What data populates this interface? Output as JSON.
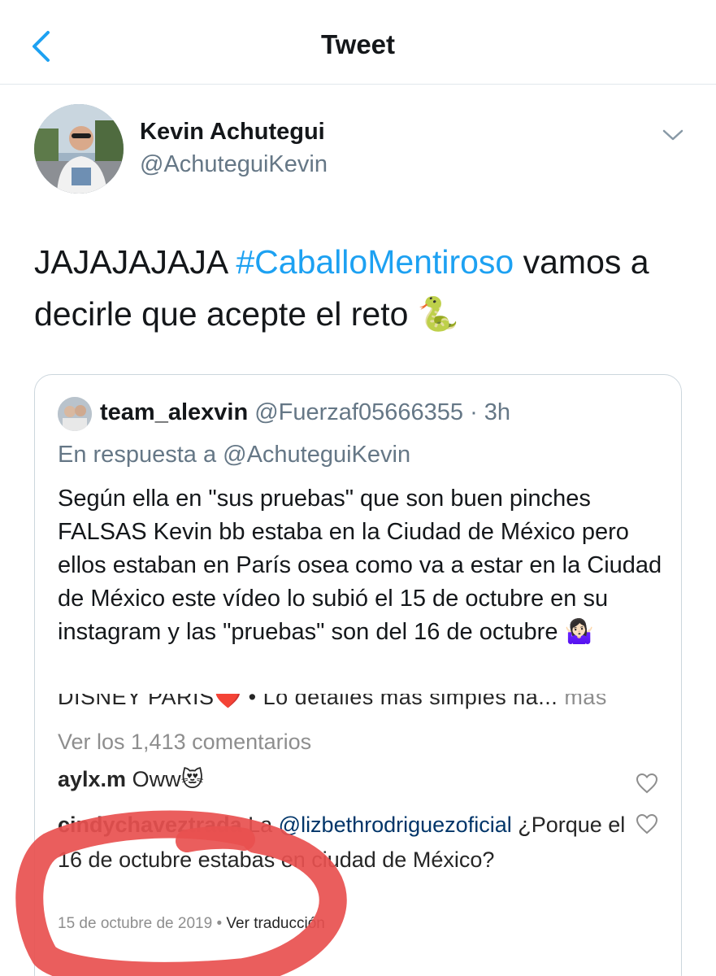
{
  "nav": {
    "title": "Tweet"
  },
  "tweet": {
    "author_name": "Kevin Achutegui",
    "author_handle": "@AchuteguiKevin",
    "text_before": "JAJAJAJAJA ",
    "hashtag": "#CaballoMentiroso",
    "text_after": " vamos a decirle que acepte el reto ",
    "emoji": "🐍"
  },
  "quote": {
    "name": "team_alexvin",
    "handle": "@Fuerzaf05666355",
    "sep": " · ",
    "time": "3h",
    "reply_to": "En respuesta a @AchuteguiKevin",
    "text": "Según ella en \"sus pruebas\" que son buen pinches FALSAS Kevin bb estaba en la Ciudad de México pero ellos estaban en París osea como va a estar en la Ciudad de México este vídeo lo subió el 15 de octubre en su instagram y las \"pruebas\" son del 16 de octubre ",
    "emoji": "🤷🏻‍♀️"
  },
  "instagram": {
    "caption_top": "DISNEY PARIS❤️ • Lo detalles mas simples ha...",
    "caption_more": " más",
    "view_all": "Ver los 1,413 comentarios",
    "comment1_user": "aylx.m",
    "comment1_text": " Oww😻",
    "comment2_user": "cindychaveztrada",
    "comment2_pre": " La ",
    "comment2_mention": "@lizbethrodriguezoficial",
    "comment2_text": " ¿Porque el 16 de octubre estabas en ciudad de México?",
    "date": "15 de octubre de 2019",
    "date_sep": " • ",
    "translate": "Ver traducción"
  },
  "colors": {
    "accent": "#1da1f2",
    "annotation": "#e8504f",
    "secondary_text": "#657786"
  }
}
